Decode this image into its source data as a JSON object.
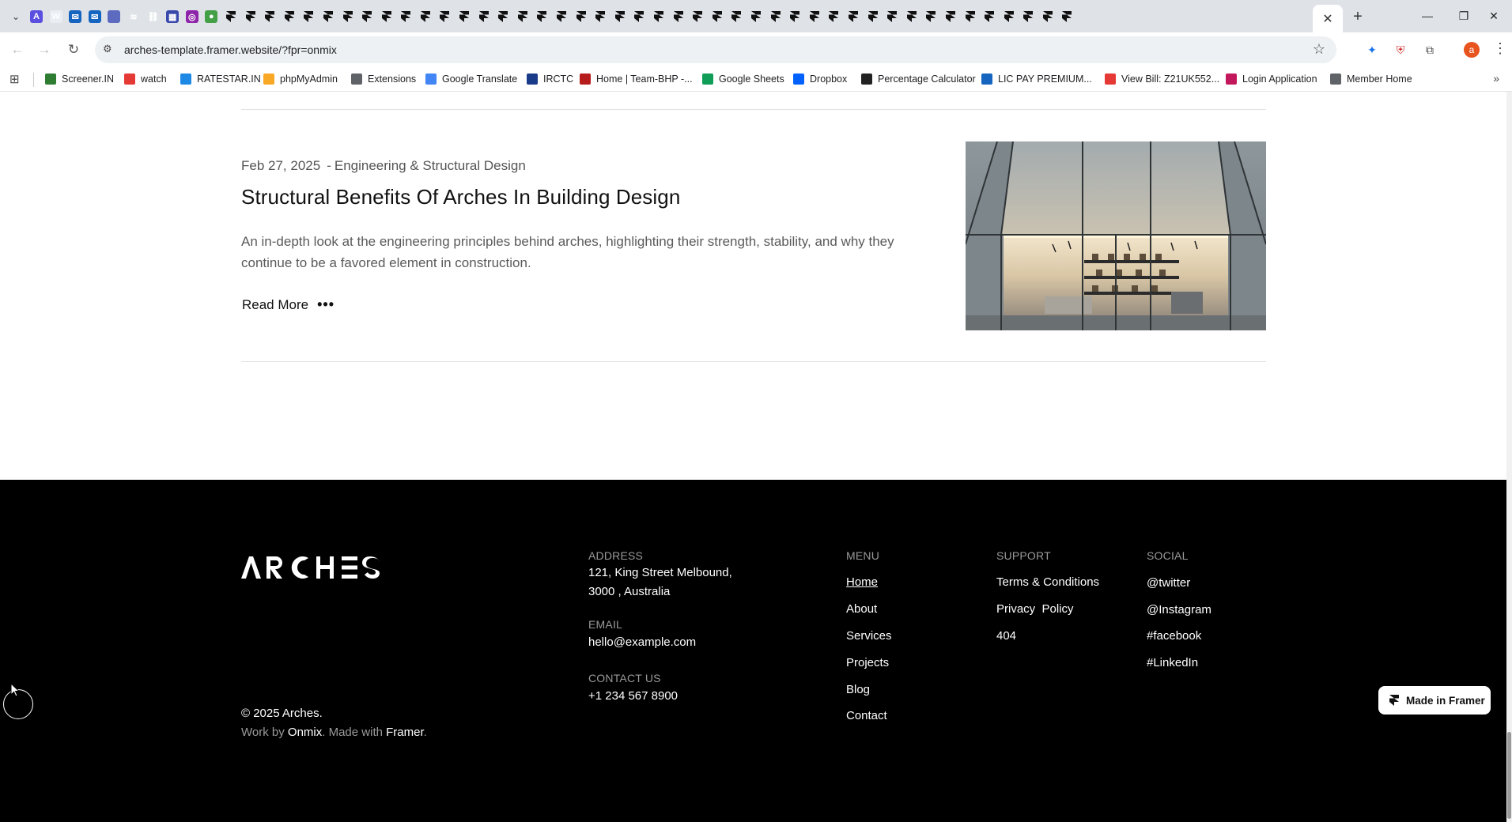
{
  "browser": {
    "active_tab_close": "✕",
    "new_tab": "+",
    "url": "arches-template.framer.website/?fpr=onmix",
    "avatar_letter": "a",
    "bookmarks": [
      {
        "label": "Screener.IN",
        "color": "#2e7d32"
      },
      {
        "label": "watch",
        "color": "#e53935"
      },
      {
        "label": "RATESTAR.IN",
        "color": "#1e88e5"
      },
      {
        "label": "phpMyAdmin",
        "color": "#f9a825"
      },
      {
        "label": "Extensions",
        "color": "#5f6368"
      },
      {
        "label": "Google Translate",
        "color": "#4285f4"
      },
      {
        "label": "IRCTC",
        "color": "#1a3a8a"
      },
      {
        "label": "Home | Team-BHP -...",
        "color": "#b71c1c"
      },
      {
        "label": "Google Sheets",
        "color": "#0f9d58"
      },
      {
        "label": "Dropbox",
        "color": "#0061ff"
      },
      {
        "label": "Percentage Calculator",
        "color": "#222222"
      },
      {
        "label": "LIC PAY PREMIUM...",
        "color": "#1565c0"
      },
      {
        "label": "View Bill: Z21UK552...",
        "color": "#e53935"
      },
      {
        "label": "Login Application",
        "color": "#c2185b"
      },
      {
        "label": "Member Home",
        "color": "#5f6368"
      }
    ]
  },
  "post": {
    "date": "Feb 27, 2025",
    "separator": "-",
    "category": "Engineering & Structural Design",
    "title": "Structural Benefits Of Arches In Building Design",
    "excerpt": "An in-depth look at the engineering principles behind arches, highlighting their strength, stability, and why they continue to be a favored element in construction.",
    "read_more": "Read More",
    "read_more_dots": "•••"
  },
  "footer": {
    "logo_text": "ARCHES",
    "copyright": "© 2025 Arches.",
    "work_by_prefix": "Work by ",
    "work_by_name": "Onmix",
    "made_with_prefix": ". Made with ",
    "made_with_name": "Framer",
    "made_with_suffix": ".",
    "address_label": "ADDRESS",
    "address_line1": "121, King Street Melbound,",
    "address_line2": "3000 , Australia",
    "email_label": "EMAIL",
    "email": "hello@example.com",
    "contact_label": "CONTACT US",
    "phone": "+1 234 567 8900",
    "menu_label": "MENU",
    "menu": [
      "Home",
      "About",
      "Services",
      "Projects",
      "Blog",
      "Contact"
    ],
    "support_label": "SUPPORT",
    "support": [
      "Terms & Conditions",
      "Privacy  Policy",
      "404"
    ],
    "social_label": "SOCIAL",
    "social": [
      "@twitter",
      "@Instagram",
      "#facebook",
      "#LinkedIn"
    ]
  },
  "badge": {
    "made_in_framer": "Made in Framer"
  }
}
